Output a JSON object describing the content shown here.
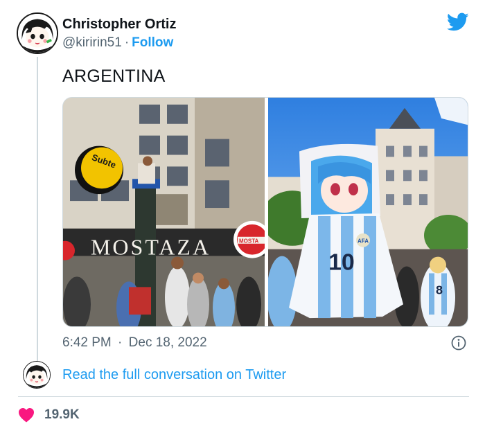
{
  "tweet": {
    "author_name": "Christopher Ortiz",
    "author_handle": "@kiririn51",
    "separator": "·",
    "follow_label": "Follow",
    "text": "ARGENTINA",
    "time": "6:42 PM",
    "date_separator": "·",
    "date": "Dec 18, 2022",
    "read_conversation_label": "Read the full conversation on Twitter",
    "like_count": "19.9K"
  },
  "photo_left": {
    "subte_sign": "Subte",
    "store_name": "MOSTAZA",
    "store_logo_text": "MOSTA"
  },
  "photo_right": {
    "jersey_number": "10",
    "jersey_number_small": "8",
    "badge_text": "AFA"
  },
  "icons": {
    "brand": "twitter-bird-icon",
    "info": "info-icon",
    "like": "heart-icon"
  },
  "colors": {
    "twitter_blue": "#1d9bf0",
    "heart": "#f91880",
    "secondary_text": "#536471"
  }
}
